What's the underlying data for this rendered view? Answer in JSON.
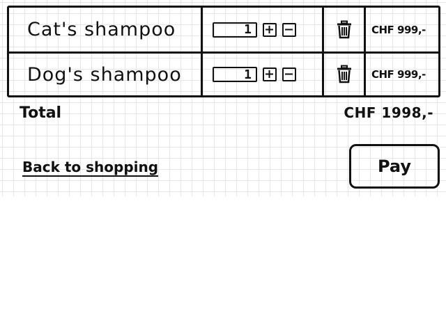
{
  "cart": {
    "items": [
      {
        "name": "Cat's shampoo",
        "quantity": "1",
        "price": "CHF 999,-"
      },
      {
        "name": "Dog's shampoo",
        "quantity": "1",
        "price": "CHF 999,-"
      }
    ],
    "increment_icon": "plus-box-icon",
    "decrement_icon": "minus-box-icon",
    "delete_icon": "trash-icon"
  },
  "summary": {
    "total_label": "Total",
    "total_value": "CHF 1998,-"
  },
  "actions": {
    "back_label": "Back to shopping",
    "pay_label": "Pay"
  },
  "colors": {
    "ink": "#111111",
    "grid": "#e6e6e6",
    "background": "#ffffff"
  }
}
